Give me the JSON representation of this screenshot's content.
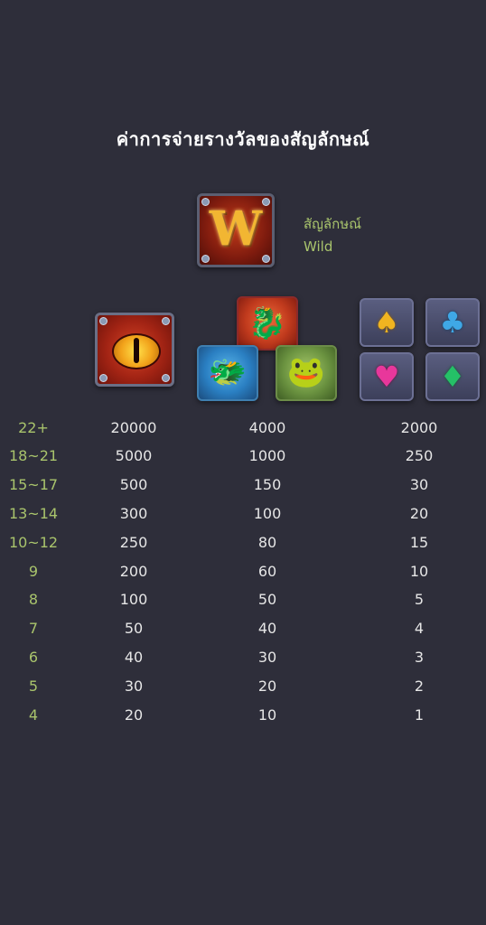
{
  "title": "ค่าการจ่ายรางวัลของสัญลักษณ์",
  "wild": {
    "symbol_letter": "W",
    "label_thai": "สัญลักษณ์",
    "label_en": "Wild"
  },
  "symbols": {
    "eye": "dragon-eye",
    "dragons": [
      "red-dragon",
      "blue-dragon",
      "green-dragon"
    ],
    "suits": [
      "spade",
      "club",
      "heart",
      "diamond"
    ],
    "suit_glyphs": {
      "spade": "♠",
      "club": "♣",
      "heart": "♥",
      "diamond": "♦"
    },
    "creature_glyphs": {
      "red": "🐉",
      "blue": "🐲",
      "green": "🐸"
    }
  },
  "colors": {
    "background": "#2e2e3a",
    "count_label": "#a9c46c",
    "value_text": "#e6e6e6",
    "title": "#ffffff"
  },
  "paytable": {
    "rows": [
      {
        "count": "22+",
        "eye": "20000",
        "dragon": "4000",
        "suit": "2000"
      },
      {
        "count": "18~21",
        "eye": "5000",
        "dragon": "1000",
        "suit": "250"
      },
      {
        "count": "15~17",
        "eye": "500",
        "dragon": "150",
        "suit": "30"
      },
      {
        "count": "13~14",
        "eye": "300",
        "dragon": "100",
        "suit": "20"
      },
      {
        "count": "10~12",
        "eye": "250",
        "dragon": "80",
        "suit": "15"
      },
      {
        "count": "9",
        "eye": "200",
        "dragon": "60",
        "suit": "10"
      },
      {
        "count": "8",
        "eye": "100",
        "dragon": "50",
        "suit": "5"
      },
      {
        "count": "7",
        "eye": "50",
        "dragon": "40",
        "suit": "4"
      },
      {
        "count": "6",
        "eye": "40",
        "dragon": "30",
        "suit": "3"
      },
      {
        "count": "5",
        "eye": "30",
        "dragon": "20",
        "suit": "2"
      },
      {
        "count": "4",
        "eye": "20",
        "dragon": "10",
        "suit": "1"
      }
    ]
  }
}
